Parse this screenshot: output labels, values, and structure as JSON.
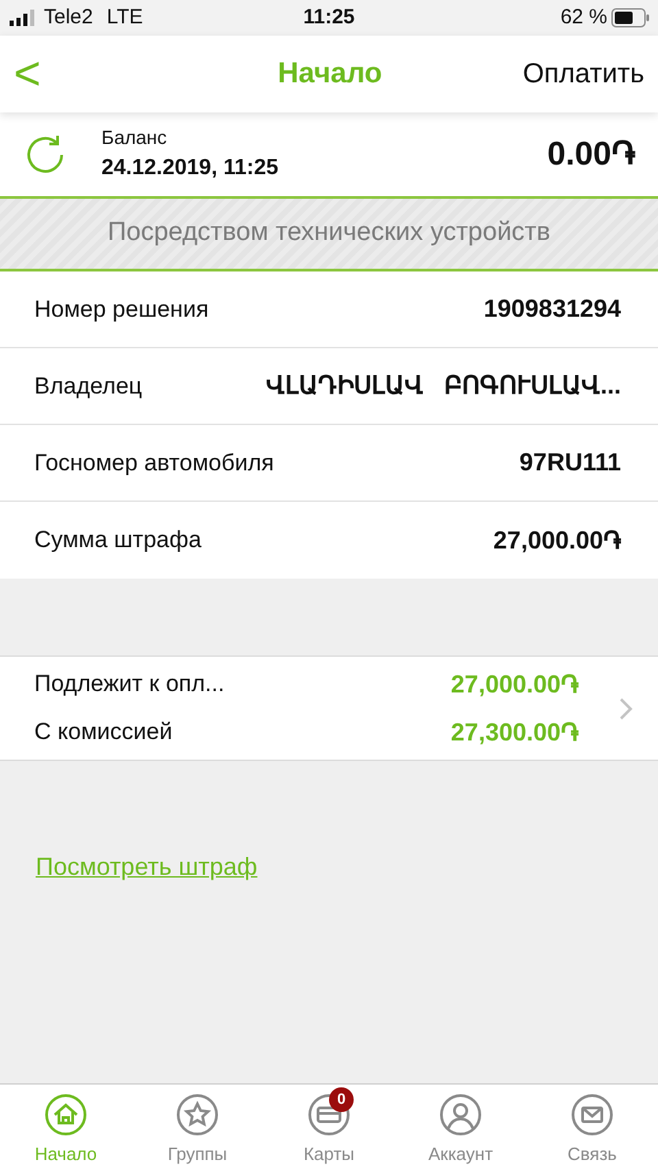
{
  "status_bar": {
    "carrier": "Tele2",
    "network": "LTE",
    "time": "11:25",
    "battery": "62 %"
  },
  "nav": {
    "back": "<",
    "title": "Начало",
    "action": "Оплатить"
  },
  "balance": {
    "label": "Баланс",
    "date": "24.12.2019, 11:25",
    "amount": "0.00֏"
  },
  "section_title": "Посредством технических устройств",
  "details": [
    {
      "label": "Номер решения",
      "value": "1909831294"
    },
    {
      "label": "Владелец",
      "value": "ՎԼԱԴԻՍԼԱՎ   ԲՈԳՈՒՍԼԱՎ..."
    },
    {
      "label": "Госномер автомобиля",
      "value": "97RU111"
    },
    {
      "label": "Сумма штрафа",
      "value": "27,000.00֏"
    }
  ],
  "payment": [
    {
      "label": "Подлежит к опл...",
      "value": "27,000.00֏"
    },
    {
      "label": "С комиссией",
      "value": "27,300.00֏"
    }
  ],
  "link": "Посмотреть штраф",
  "tabs": [
    {
      "label": "Начало",
      "kind": "home",
      "selected": true
    },
    {
      "label": "Группы",
      "kind": "star",
      "selected": false
    },
    {
      "label": "Карты",
      "kind": "card",
      "selected": false,
      "badge": "0"
    },
    {
      "label": "Аккаунт",
      "kind": "account",
      "selected": false
    },
    {
      "label": "Связь",
      "kind": "mail",
      "selected": false
    }
  ]
}
